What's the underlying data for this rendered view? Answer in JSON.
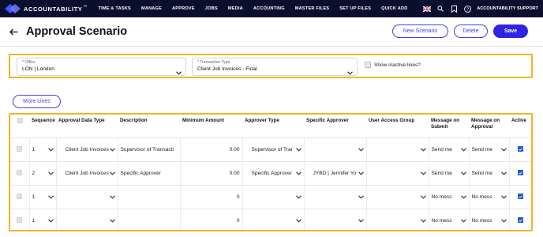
{
  "nav": {
    "logo_text": "ACCOUNTABILITY",
    "logo_tm": "™",
    "items": [
      "TIME & TASKS",
      "MANAGE",
      "APPROVE",
      "JOBS",
      "MEDIA",
      "ACCOUNTING",
      "MASTER FILES",
      "SET UP FILES",
      "QUICK ADD"
    ],
    "user": "ACCOUNTABILITY SUPPORT"
  },
  "header": {
    "title": "Approval Scenario",
    "new_scenario": "New Scenario",
    "delete": "Delete",
    "save": "Save"
  },
  "filters": {
    "office": {
      "label": "Office",
      "value": "LON | London"
    },
    "transaction_type": {
      "label": "Transaction Type",
      "value": "Client Job Invoices - Final"
    },
    "show_inactive": "Show inactive lines?"
  },
  "more_lines": "More Lines",
  "table": {
    "headers": {
      "sequence": "Sequence",
      "approval_data_type": "Approval Data Type",
      "description": "Description",
      "minimum_amount": "Minimum Amount",
      "approver_type": "Approver Type",
      "specific_approver": "Specific Approver",
      "user_access_group": "User Access Group",
      "message_on_submit": "Message on Submit",
      "message_on_approval": "Message on Approval",
      "active": "Active"
    },
    "rows": [
      {
        "sequence": "1",
        "approval_data_type": "Client Job Invoices",
        "description": "Supervisor of Transacti",
        "minimum_amount": "0.00",
        "approver_type": "Supervisor of Trar",
        "specific_approver": "",
        "user_access_group": "",
        "message_on_submit": "Send me",
        "message_on_approval": "Send me",
        "active": true
      },
      {
        "sequence": "2",
        "approval_data_type": "Client Job Invoices",
        "description": "Specific Approver",
        "minimum_amount": "0.00",
        "approver_type": "Specific Approver",
        "specific_approver": "JYBD | Jennifer Yo",
        "user_access_group": "",
        "message_on_submit": "Send me",
        "message_on_approval": "Send me",
        "active": true
      },
      {
        "sequence": "1",
        "approval_data_type": "",
        "description": "",
        "minimum_amount": "0",
        "approver_type": "",
        "specific_approver": "",
        "user_access_group": "",
        "message_on_submit": "No mess",
        "message_on_approval": "No mess",
        "active": true
      },
      {
        "sequence": "1",
        "approval_data_type": "",
        "description": "",
        "minimum_amount": "0",
        "approver_type": "",
        "specific_approver": "",
        "user_access_group": "",
        "message_on_submit": "No mess",
        "message_on_approval": "No mess",
        "active": true
      }
    ]
  },
  "colors": {
    "nav_bg": "#0b0f2e",
    "primary": "#2f23e6",
    "highlight_border": "#f4b324",
    "checkbox": "#1f57d6"
  }
}
